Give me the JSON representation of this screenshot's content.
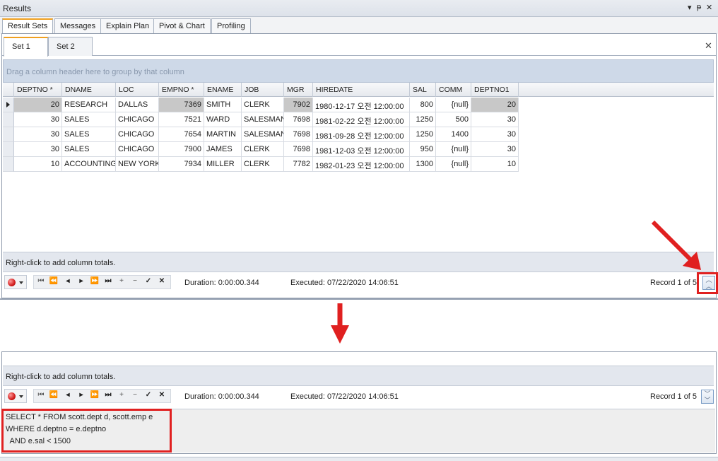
{
  "window": {
    "title": "Results",
    "pin_icon": "pin-icon",
    "close_icon": "close-icon"
  },
  "main_tabs": [
    "Result Sets",
    "Messages",
    "Explain Plan",
    "Pivot & Chart",
    "Profiling"
  ],
  "set_tabs": [
    "Set 1",
    "Set 2"
  ],
  "group_hint": "Drag a column header here to group by that column",
  "columns": [
    "DEPTNO *",
    "DNAME",
    "LOC",
    "EMPNO *",
    "ENAME",
    "JOB",
    "MGR",
    "HIREDATE",
    "SAL",
    "COMM",
    "DEPTNO1"
  ],
  "rows": [
    [
      "20",
      "RESEARCH",
      "DALLAS",
      "7369",
      "SMITH",
      "CLERK",
      "7902",
      "1980-12-17 오전 12:00:00",
      "800",
      "{null}",
      "20"
    ],
    [
      "30",
      "SALES",
      "CHICAGO",
      "7521",
      "WARD",
      "SALESMAN",
      "7698",
      "1981-02-22 오전 12:00:00",
      "1250",
      "500",
      "30"
    ],
    [
      "30",
      "SALES",
      "CHICAGO",
      "7654",
      "MARTIN",
      "SALESMAN",
      "7698",
      "1981-09-28 오전 12:00:00",
      "1250",
      "1400",
      "30"
    ],
    [
      "30",
      "SALES",
      "CHICAGO",
      "7900",
      "JAMES",
      "CLERK",
      "7698",
      "1981-12-03 오전 12:00:00",
      "950",
      "{null}",
      "30"
    ],
    [
      "10",
      "ACCOUNTING",
      "NEW YORK",
      "7934",
      "MILLER",
      "CLERK",
      "7782",
      "1982-01-23 오전 12:00:00",
      "1300",
      "{null}",
      "10"
    ]
  ],
  "totals_hint": "Right-click to add column totals.",
  "status": {
    "duration": "Duration: 0:00:00.344",
    "executed": "Executed: 07/22/2020 14:06:51",
    "record": "Record 1 of 5"
  },
  "sql_lines": [
    "SELECT * FROM scott.dept d, scott.emp e",
    "WHERE d.deptno = e.deptno",
    "  AND e.sal < 1500"
  ],
  "colors": {
    "annotation_red": "#e02020",
    "active_tab_accent": "#f0a020",
    "selected_cell_gray": "#c8c8c8"
  }
}
